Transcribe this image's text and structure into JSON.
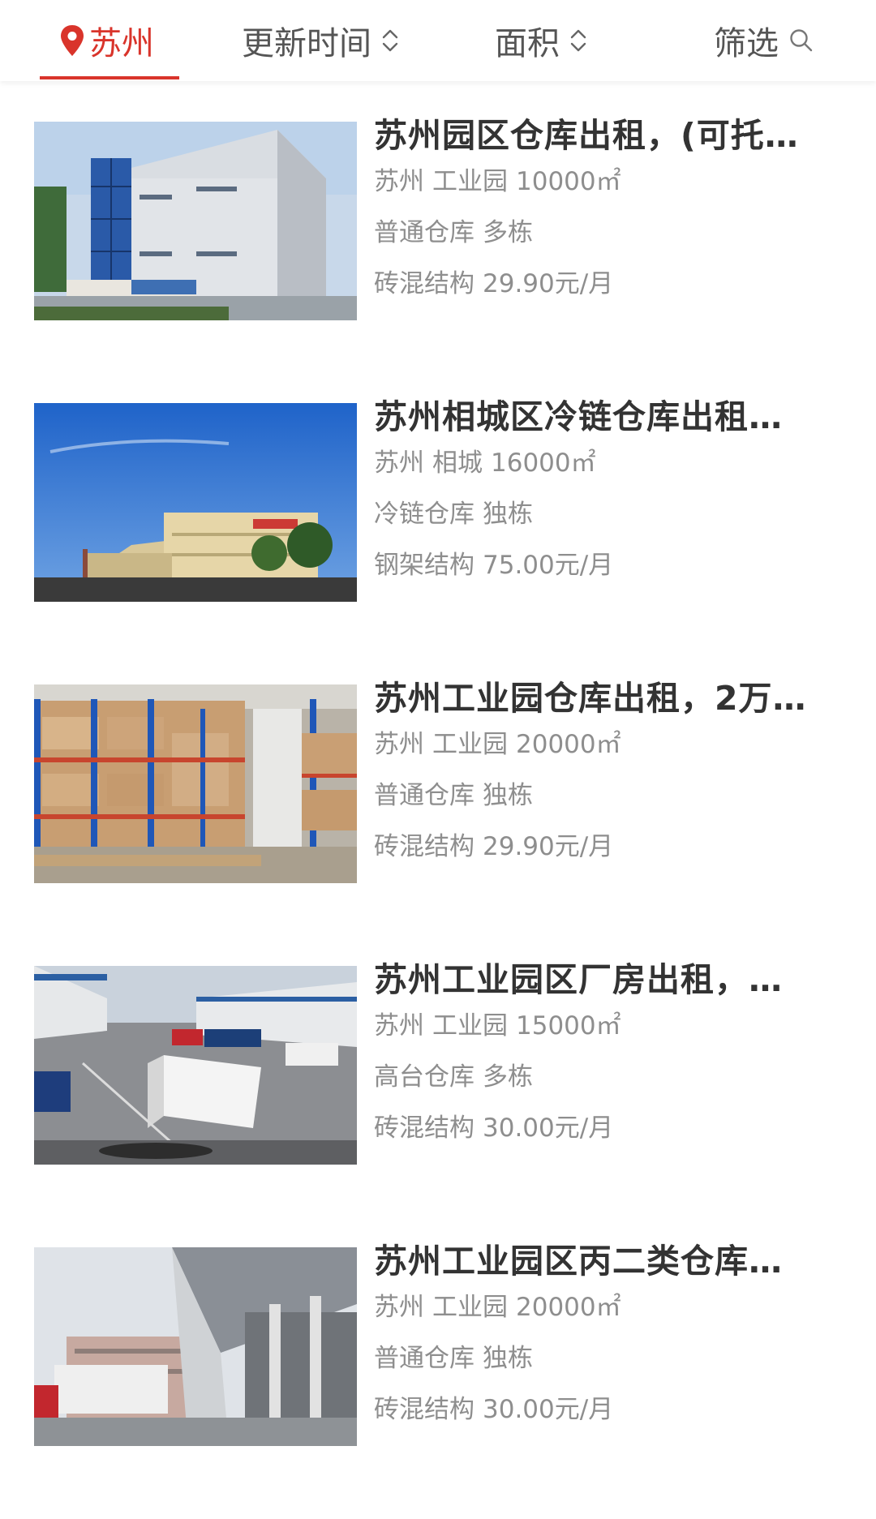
{
  "colors": {
    "accent": "#d9342b",
    "title_text": "#333333",
    "meta_text": "#8e8e8e"
  },
  "tabs": {
    "city": {
      "label": "苏州",
      "icon": "location-pin-icon"
    },
    "update_time": {
      "label": "更新时间",
      "icon": "sort-arrows-icon"
    },
    "area": {
      "label": "面积",
      "icon": "sort-arrows-icon"
    },
    "filter": {
      "label": "筛选",
      "icon": "search-icon"
    }
  },
  "listings": [
    {
      "title": "苏州园区仓库出租，(可托…",
      "city": "苏州",
      "district": "工业园",
      "area": "10000㎡",
      "category": "普通仓库",
      "building": "多栋",
      "structure": "砖混结构",
      "price": "29.90元/月",
      "image": "warehouse-exterior-photo"
    },
    {
      "title": "苏州相城区冷链仓库出租…",
      "city": "苏州",
      "district": "相城",
      "area": "16000㎡",
      "category": "冷链仓库",
      "building": "独栋",
      "structure": "钢架结构",
      "price": "75.00元/月",
      "image": "cold-chain-warehouse-photo"
    },
    {
      "title": "苏州工业园仓库出租，2万…",
      "city": "苏州",
      "district": "工业园",
      "area": "20000㎡",
      "category": "普通仓库",
      "building": "独栋",
      "structure": "砖混结构",
      "price": "29.90元/月",
      "image": "warehouse-racks-photo"
    },
    {
      "title": "苏州工业园区厂房出租，…",
      "city": "苏州",
      "district": "工业园",
      "area": "15000㎡",
      "category": "高台仓库",
      "building": "多栋",
      "structure": "砖混结构",
      "price": "30.00元/月",
      "image": "loading-dock-trucks-photo"
    },
    {
      "title": "苏州工业园区丙二类仓库…",
      "city": "苏州",
      "district": "工业园",
      "area": "20000㎡",
      "category": "普通仓库",
      "building": "独栋",
      "structure": "砖混结构",
      "price": "30.00元/月",
      "image": "warehouse-canopy-truck-photo"
    }
  ]
}
